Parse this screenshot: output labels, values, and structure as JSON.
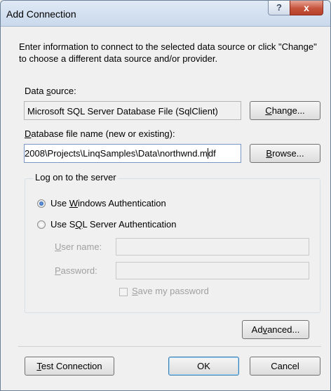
{
  "window": {
    "title": "Add Connection",
    "help_glyph": "?",
    "close_glyph": "x"
  },
  "intro_text": "Enter information to connect to the selected data source or click \"Change\" to choose a different data source and/or provider.",
  "data_source": {
    "label": "Data source:",
    "value": "Microsoft SQL Server Database File (SqlClient)",
    "change_button": "Change..."
  },
  "database_file": {
    "label": "Database file name (new or existing):",
    "value": "2008\\Projects\\LinqSamples\\Data\\northwnd.mdf",
    "browse_button": "Browse..."
  },
  "logon": {
    "group_title": "Log on to the server",
    "options": [
      {
        "label": "Use Windows Authentication",
        "selected": true
      },
      {
        "label": "Use SQL Server Authentication",
        "selected": false
      }
    ],
    "user_name_label": "User name:",
    "user_name_value": "",
    "password_label": "Password:",
    "password_value": "",
    "save_password_label": "Save my password",
    "save_password_checked": false
  },
  "advanced_button": "Advanced...",
  "footer": {
    "test_connection_button": "Test Connection",
    "ok_button": "OK",
    "cancel_button": "Cancel"
  },
  "colors": {
    "title_bar": "#c9d9ec",
    "close_button": "#c6533c",
    "default_button_border": "#3c7fb1"
  },
  "icons": {
    "help": "help-icon",
    "close": "close-icon"
  }
}
